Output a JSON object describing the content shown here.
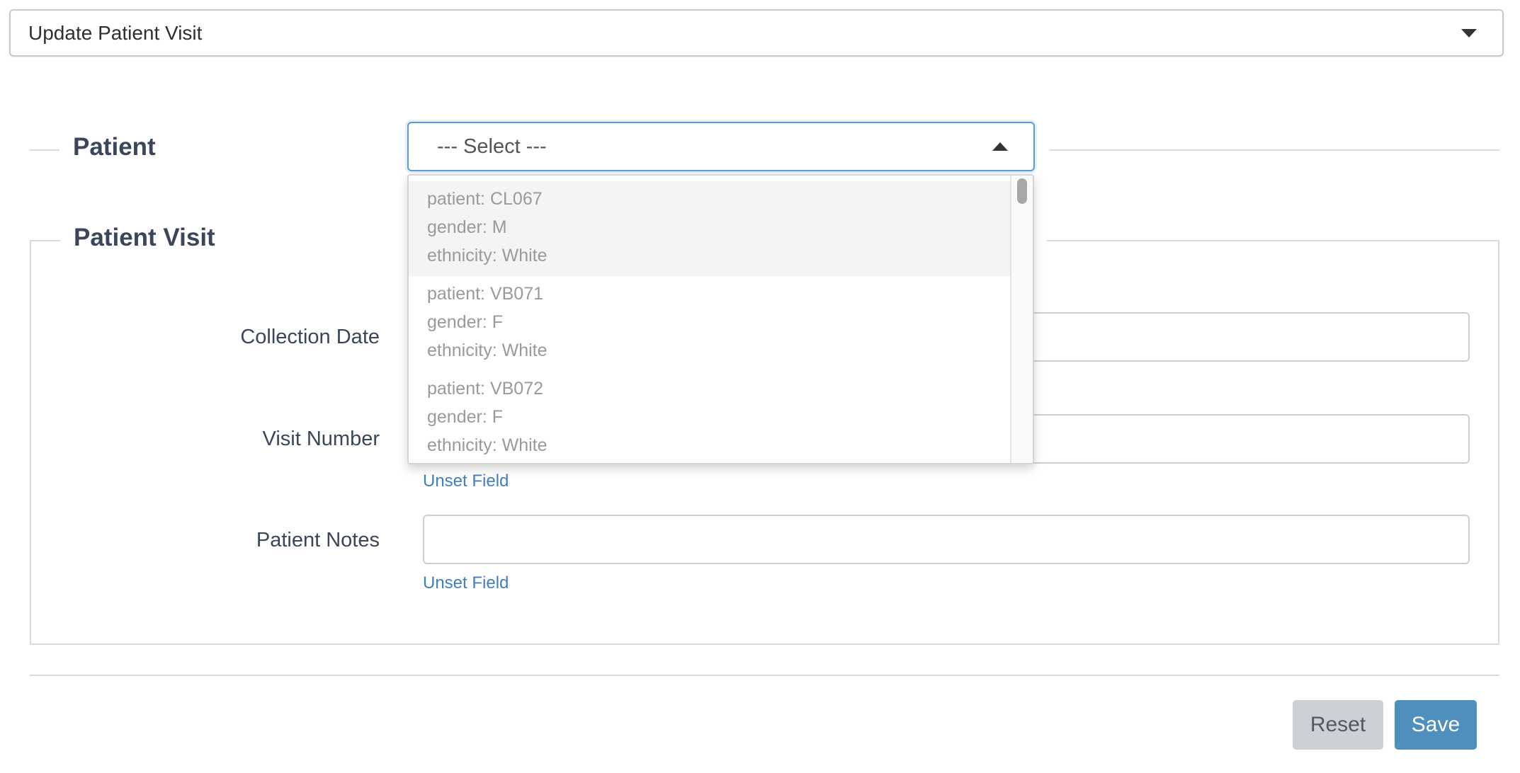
{
  "mode_select": {
    "value": "Update Patient Visit"
  },
  "patient_section": {
    "legend": "Patient",
    "select_placeholder": "--- Select ---",
    "options": [
      {
        "patient": "patient: CL067",
        "gender": "gender: M",
        "ethnicity": "ethnicity: White"
      },
      {
        "patient": "patient: VB071",
        "gender": "gender: F",
        "ethnicity": "ethnicity: White"
      },
      {
        "patient": "patient: VB072",
        "gender": "gender: F",
        "ethnicity": "ethnicity: White"
      }
    ]
  },
  "visit_section": {
    "legend": "Patient Visit",
    "fields": [
      {
        "label": "Collection Date",
        "value": ""
      },
      {
        "label": "Visit Number",
        "value": "",
        "unset": "Unset Field"
      },
      {
        "label": "Patient Notes",
        "value": "",
        "unset": "Unset Field"
      }
    ]
  },
  "actions": {
    "reset": "Reset",
    "save": "Save"
  },
  "colors": {
    "accent": "#4f8fbd",
    "link": "#3e7fc0",
    "focus": "#5b9dd9"
  }
}
